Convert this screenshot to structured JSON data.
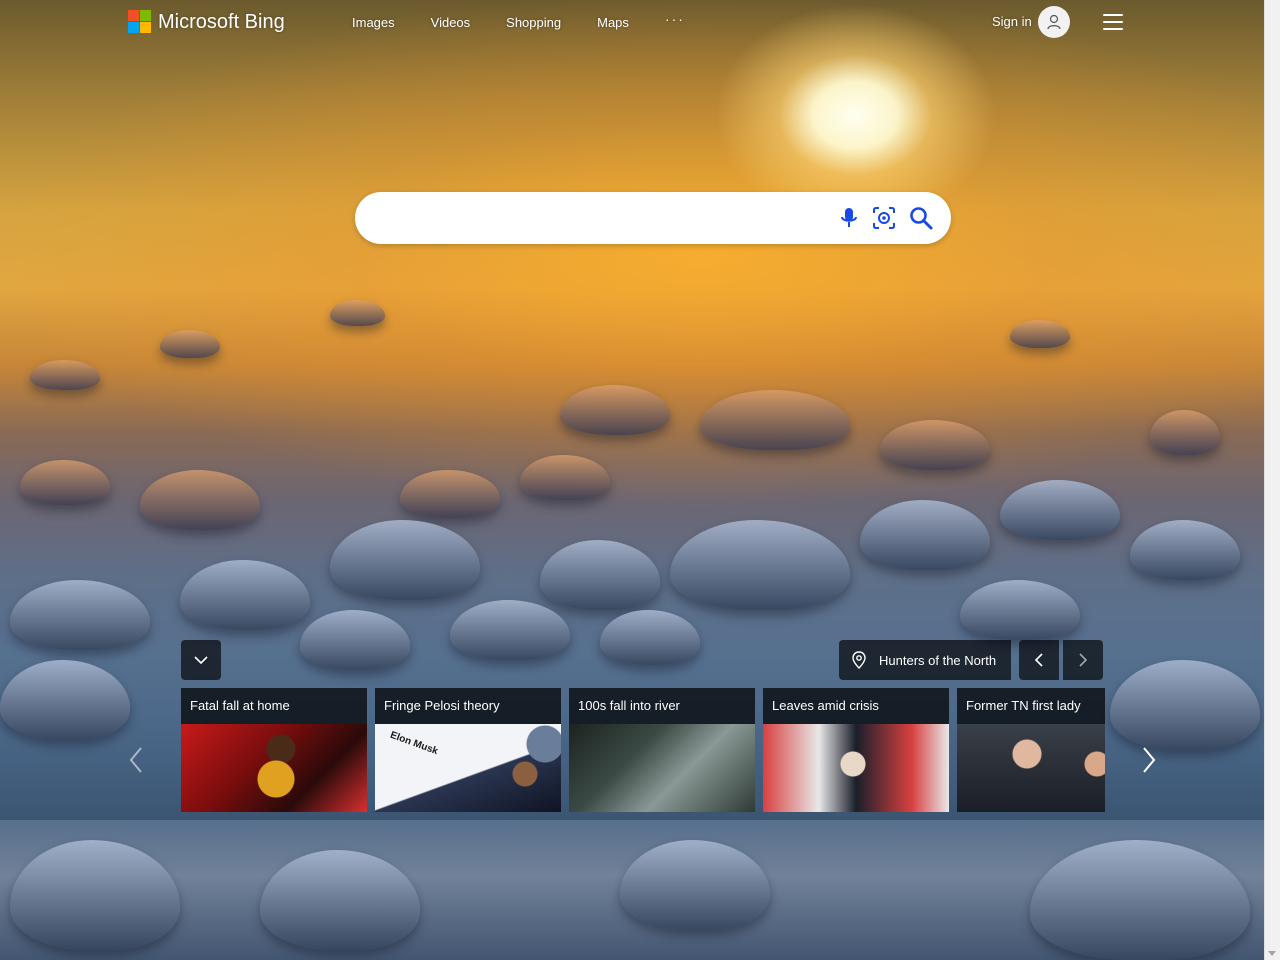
{
  "header": {
    "logo_text": "Microsoft Bing",
    "nav": [
      "Images",
      "Videos",
      "Shopping",
      "Maps"
    ],
    "more": "···",
    "signin": "Sign in"
  },
  "search": {
    "value": "",
    "placeholder": ""
  },
  "image_info": {
    "location": "Hunters of the North"
  },
  "news": [
    {
      "title": "Fatal fall at home"
    },
    {
      "title": "Fringe Pelosi theory",
      "image_text": "Elon Musk"
    },
    {
      "title": "100s fall into river"
    },
    {
      "title": "Leaves amid crisis"
    },
    {
      "title": "Former TN first lady"
    }
  ],
  "icons": {
    "logo": "microsoft-logo-icon",
    "avatar": "user-icon",
    "menu": "hamburger-icon",
    "mic": "microphone-icon",
    "visual_search": "visual-search-icon",
    "search": "search-icon",
    "pin": "location-pin-icon"
  },
  "colors": {
    "accent_blue": "#174ae4",
    "logo_red": "#f25022",
    "logo_green": "#7fba00",
    "logo_blue": "#00a4ef",
    "logo_yellow": "#ffb900"
  }
}
